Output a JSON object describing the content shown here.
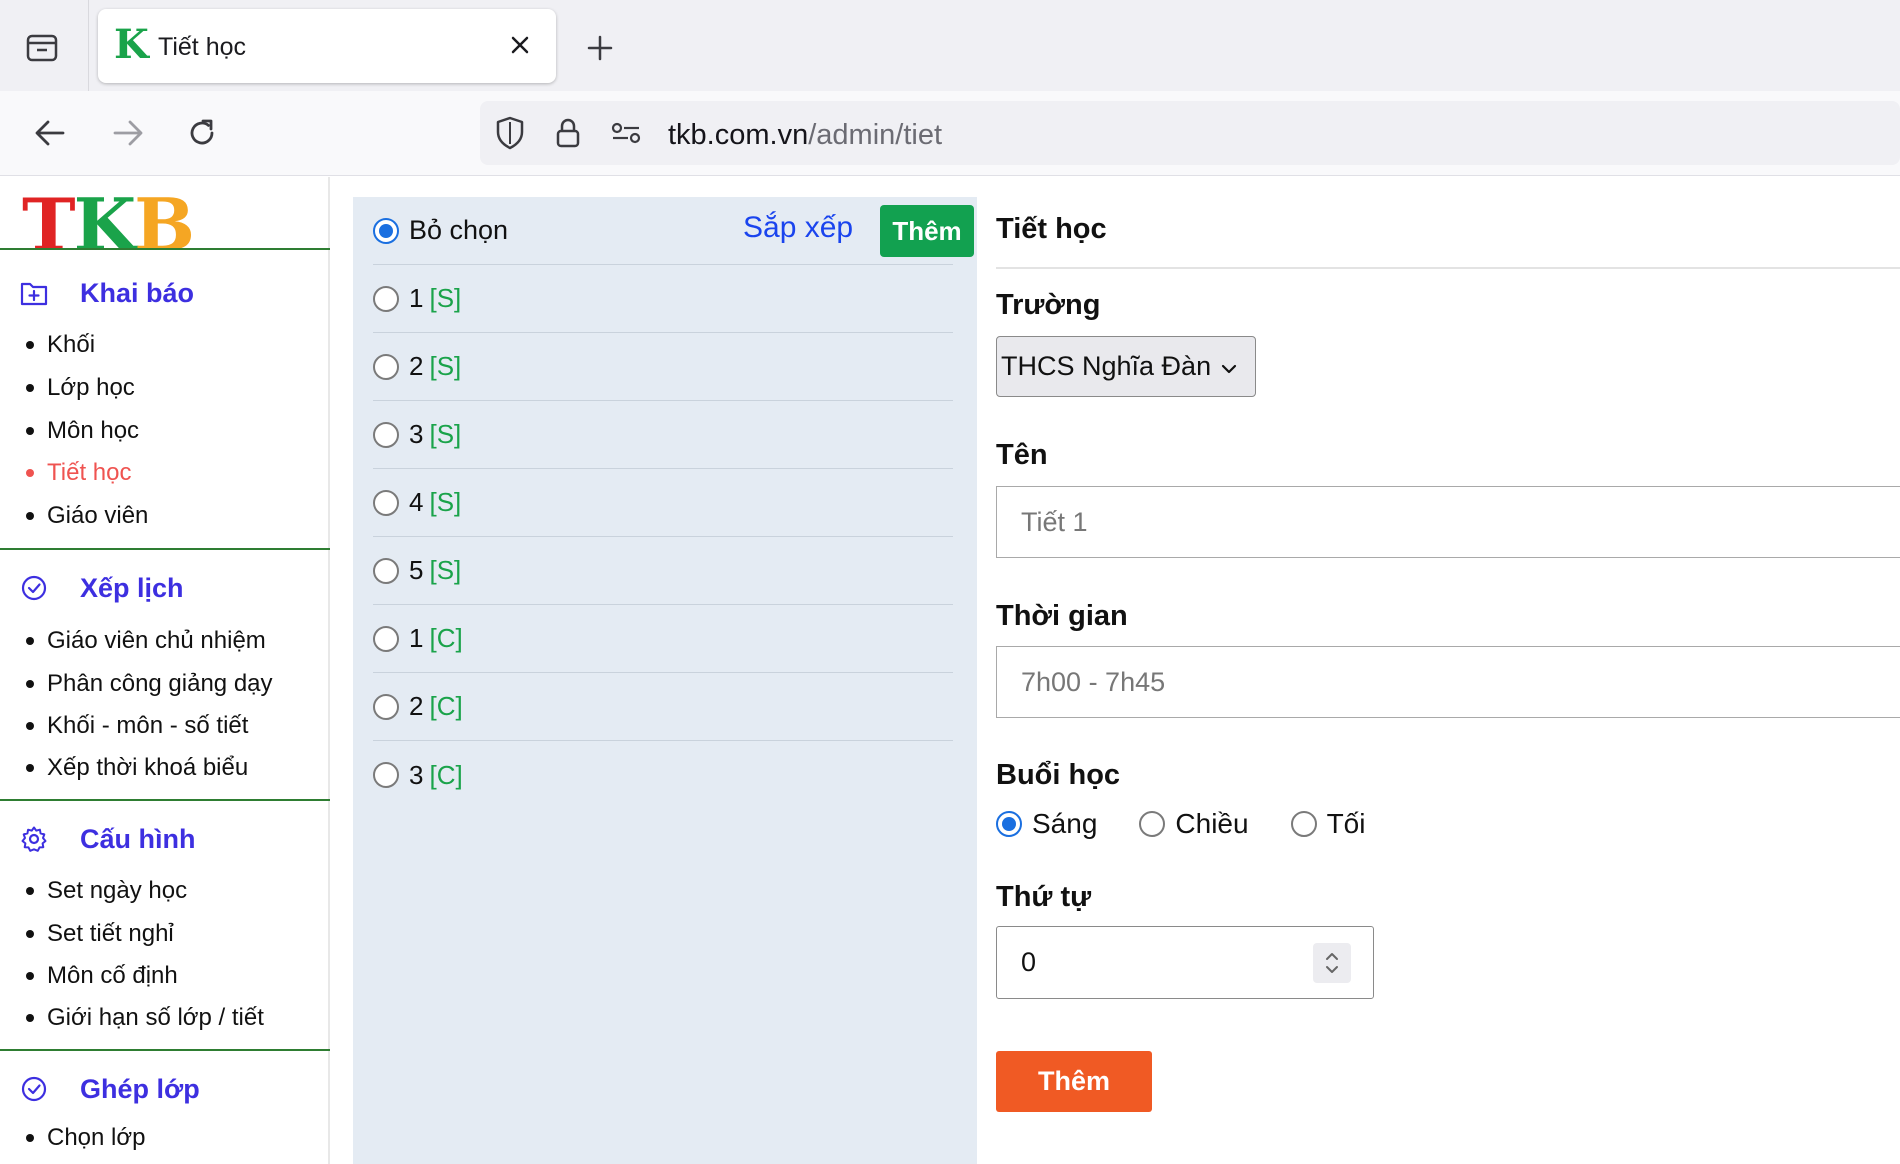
{
  "browser": {
    "tab_title": "Tiết học",
    "tab_logo_letter": "K",
    "url_host": "tkb.com.vn",
    "url_path": "/admin/tiet"
  },
  "sidebar": {
    "logo": {
      "l1": "T",
      "l2": "K",
      "l3": "B"
    },
    "sections": [
      {
        "title": "Khai báo",
        "icon": "plus-square-icon",
        "items": [
          "Khối",
          "Lớp học",
          "Môn học",
          "Tiết học",
          "Giáo viên"
        ]
      },
      {
        "title": "Xếp lịch",
        "icon": "check-circle-icon",
        "items": [
          "Giáo viên chủ nhiệm",
          "Phân công giảng dạy",
          "Khối - môn - số tiết",
          "Xếp thời khoá biểu"
        ]
      },
      {
        "title": "Cấu hình",
        "icon": "gear-icon",
        "items": [
          "Set ngày học",
          "Set tiết nghỉ",
          "Môn cố định",
          "Giới hạn số lớp / tiết"
        ]
      },
      {
        "title": "Ghép lớp",
        "icon": "check-circle-icon",
        "items": [
          "Chọn lớp"
        ]
      }
    ],
    "active_item": "Tiết học"
  },
  "list": {
    "deselect_label": "Bỏ chọn",
    "sort_label": "Sắp xếp",
    "add_label": "Thêm",
    "rows": [
      {
        "num": "1",
        "tag": "[S]"
      },
      {
        "num": "2",
        "tag": "[S]"
      },
      {
        "num": "3",
        "tag": "[S]"
      },
      {
        "num": "4",
        "tag": "[S]"
      },
      {
        "num": "5",
        "tag": "[S]"
      },
      {
        "num": "1",
        "tag": "[C]"
      },
      {
        "num": "2",
        "tag": "[C]"
      },
      {
        "num": "3",
        "tag": "[C]"
      }
    ]
  },
  "form": {
    "title": "Tiết học",
    "school_label": "Trường",
    "school_value": "THCS Nghĩa Đàn",
    "name_label": "Tên",
    "name_placeholder": "Tiết 1",
    "time_label": "Thời gian",
    "time_placeholder": "7h00 - 7h45",
    "session_label": "Buổi học",
    "session_options": [
      "Sáng",
      "Chiều",
      "Tối"
    ],
    "session_selected": "Sáng",
    "order_label": "Thứ tự",
    "order_value": "0",
    "submit_label": "Thêm"
  },
  "colors": {
    "accent_blue": "#3d2fe0",
    "green_button": "#12a150",
    "orange_button": "#f05a24",
    "active_red": "#ef5350",
    "tag_green": "#1aa34a"
  }
}
